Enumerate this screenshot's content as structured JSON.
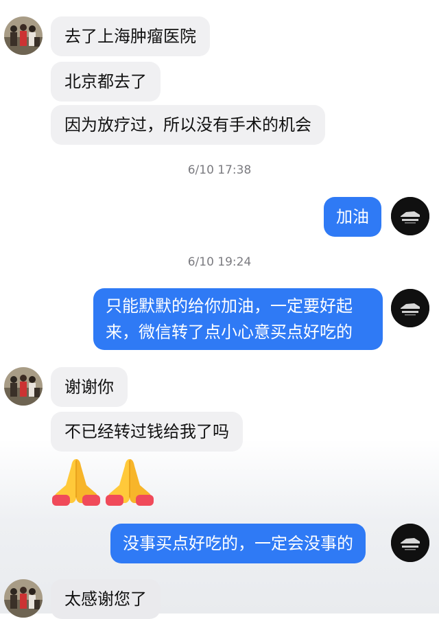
{
  "messages": {
    "m1": "去了上海肿瘤医院",
    "m2": "北京都去了",
    "m3": "因为放疗过，所以没有手术的机会",
    "ts1": "6/10 17:38",
    "m4": "加油",
    "ts2": "6/10 19:24",
    "m5_line1": "只能默默的给你加油，一定要好起",
    "m5_line2": "来，微信转了点小心意买点好吃的",
    "m6": "谢谢你",
    "m7": "不已经转过钱给我了吗",
    "m8_emoji": [
      "praying-hands",
      "praying-hands"
    ],
    "m9": "没事买点好吃的，一定会没事的",
    "m10": "太感谢您了"
  },
  "colors": {
    "incoming_bubble": "#f0f0f2",
    "outgoing_bubble": "#2f7af5",
    "timestamp_text": "#7b7b80"
  },
  "icons": {
    "contact_avatar": "group-photo-avatar",
    "self_avatar": "car-logo-avatar"
  }
}
